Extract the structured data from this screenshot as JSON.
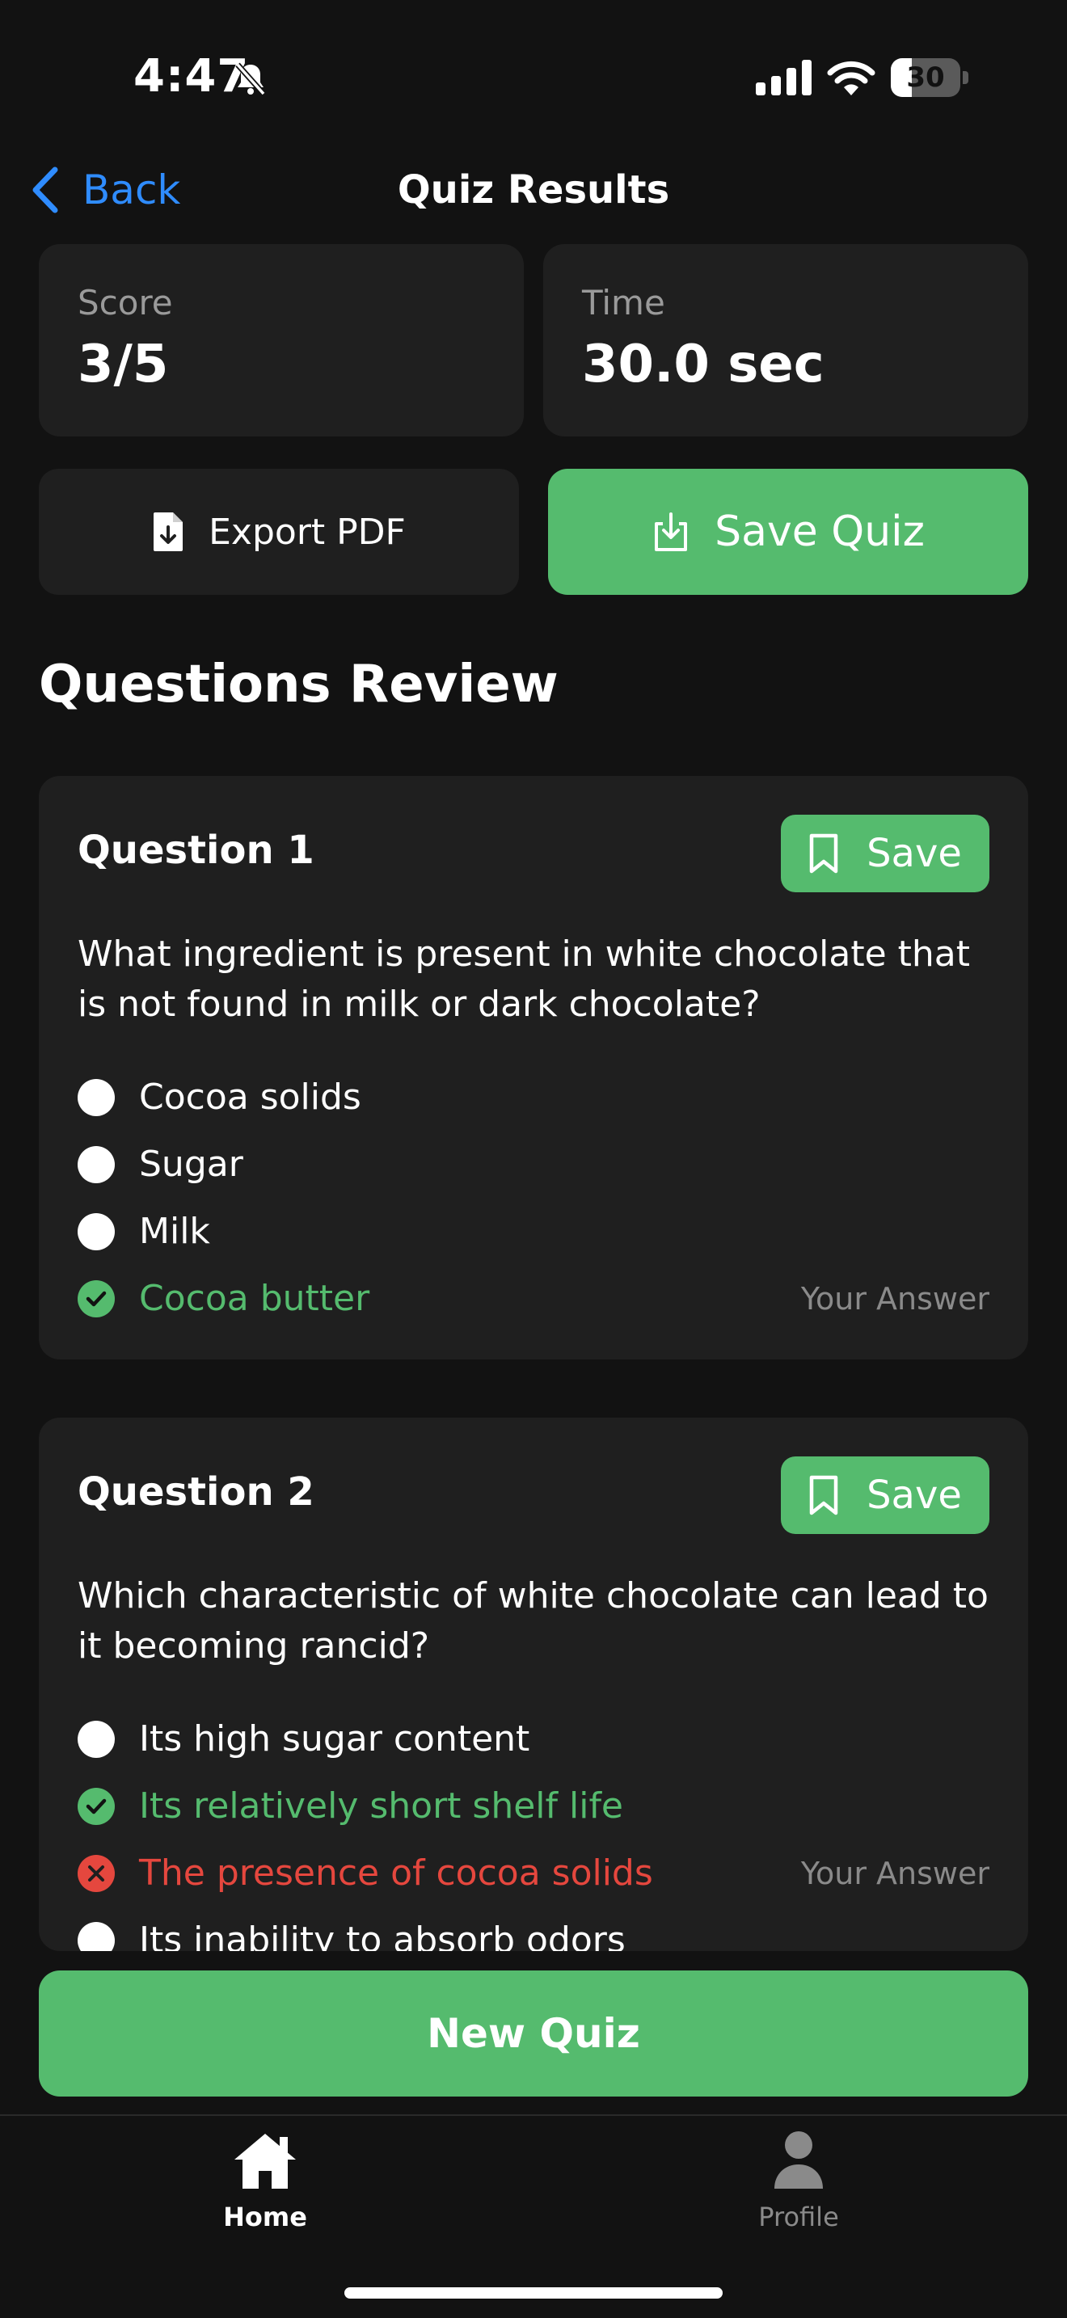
{
  "status_bar": {
    "time": "4:47",
    "battery_level": "30",
    "battery_fraction": 0.3
  },
  "nav": {
    "back_label": "Back",
    "title": "Quiz Results"
  },
  "stats": {
    "score_label": "Score",
    "score_value": "3/5",
    "time_label": "Time",
    "time_value": "30.0 sec"
  },
  "actions": {
    "export_label": "Export PDF",
    "save_label": "Save Quiz"
  },
  "review": {
    "title": "Questions Review",
    "questions": [
      {
        "title": "Question 1",
        "save_label": "Save",
        "text": "What ingredient is present in white chocolate that is not found in milk or dark chocolate?",
        "options": [
          {
            "label": "Cocoa solids",
            "state": "none"
          },
          {
            "label": "Sugar",
            "state": "none"
          },
          {
            "label": "Milk",
            "state": "none"
          },
          {
            "label": "Cocoa butter",
            "state": "correct",
            "note": "Your Answer"
          }
        ]
      },
      {
        "title": "Question 2",
        "save_label": "Save",
        "text": "Which characteristic of white chocolate can lead to it becoming rancid?",
        "options": [
          {
            "label": "Its high sugar content",
            "state": "none"
          },
          {
            "label": "Its relatively short shelf life",
            "state": "correct"
          },
          {
            "label": "The presence of cocoa solids",
            "state": "wrong",
            "note": "Your Answer"
          },
          {
            "label": "Its inability to absorb odors",
            "state": "none"
          }
        ]
      }
    ]
  },
  "new_quiz_label": "New Quiz",
  "tabs": [
    {
      "label": "Home",
      "icon": "home-icon",
      "active": true
    },
    {
      "label": "Profile",
      "icon": "person-icon",
      "active": false
    }
  ],
  "colors": {
    "accent_green": "#55bb6e",
    "wrong_red": "#e5473e",
    "link_blue": "#2f8cff",
    "background": "#121212",
    "card": "#1f1f1f"
  }
}
